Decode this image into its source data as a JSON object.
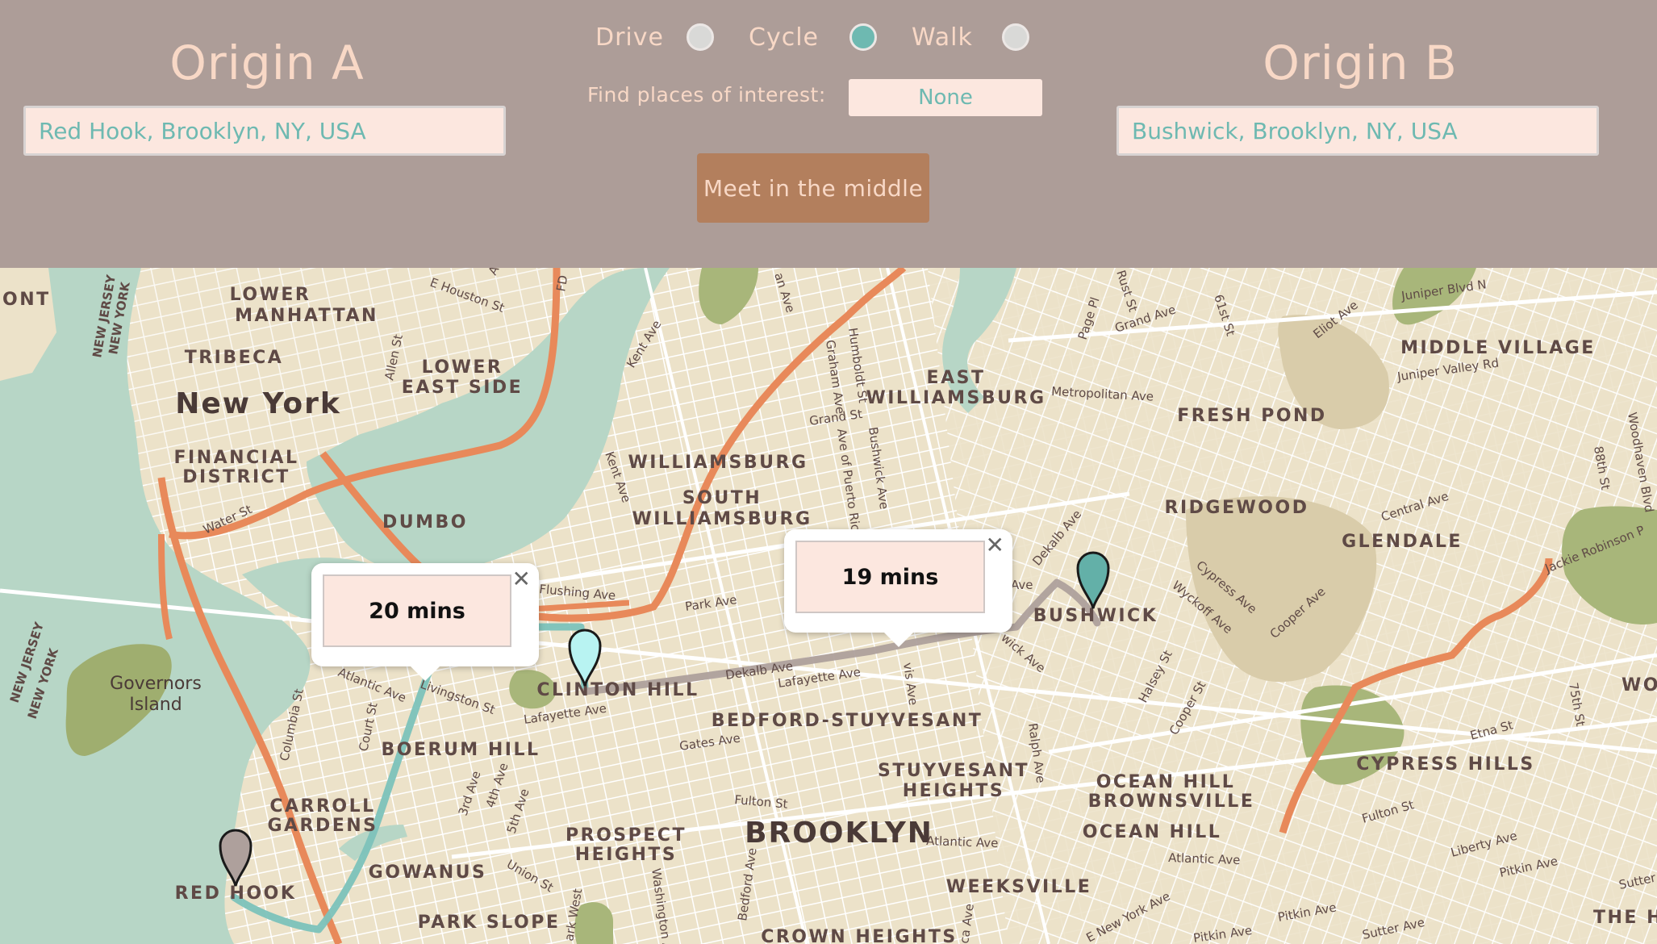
{
  "header": {
    "origin_a": {
      "title": "Origin A",
      "value": "Red Hook, Brooklyn, NY, USA"
    },
    "origin_b": {
      "title": "Origin B",
      "value": "Bushwick, Brooklyn, NY, USA"
    },
    "modes": [
      {
        "label": "Drive",
        "selected": false
      },
      {
        "label": "Cycle",
        "selected": true
      },
      {
        "label": "Walk",
        "selected": false
      }
    ],
    "poi_label": "Find places of interest:",
    "poi_value": "None",
    "meet_button": "Meet in the middle"
  },
  "colors": {
    "header_bg": "#ad9d98",
    "accent_teal": "#6eb9b1",
    "header_text": "#f8d8c6",
    "button_bg": "#b37f5d",
    "route_a": "#7cc2bb",
    "route_b": "#aea09c",
    "highway": "#e8895a"
  },
  "map": {
    "info_windows": [
      {
        "id": "a",
        "text": "20 mins"
      },
      {
        "id": "b",
        "text": "19 mins"
      }
    ],
    "markers": [
      {
        "name": "origin-a-marker",
        "color": "#aea09c"
      },
      {
        "name": "midpoint-marker",
        "color": "#b8f3f2"
      },
      {
        "name": "origin-b-marker",
        "color": "#63b0a8"
      }
    ],
    "neighborhoods": {
      "lower_manhattan_1": "LOWER",
      "lower_manhattan_2": "MANHATTAN",
      "tribeca": "TRIBECA",
      "lower_east_side_1": "LOWER",
      "lower_east_side_2": "EAST SIDE",
      "financial_district_1": "FINANCIAL",
      "financial_district_2": "DISTRICT",
      "dumbo": "DUMBO",
      "east_williamsburg_1": "EAST",
      "east_williamsburg_2": "WILLIAMSBURG",
      "williamsburg": "WILLIAMSBURG",
      "south_williamsburg_1": "SOUTH",
      "south_williamsburg_2": "WILLIAMSBURG",
      "fresh_pond": "FRESH POND",
      "ridgewood": "RIDGEWOOD",
      "middle_village": "MIDDLE VILLAGE",
      "glendale": "GLENDALE",
      "bushwick": "BUSHWICK",
      "clinton_hill": "CLINTON HILL",
      "bedford_stuyvesant": "BEDFORD-STUYVESANT",
      "boerum_hill": "BOERUM HILL",
      "stuyvesant_heights_1": "STUYVESANT",
      "stuyvesant_heights_2": "HEIGHTS",
      "ocean_hill_brownsville_1": "OCEAN HILL",
      "ocean_hill_brownsville_2": "BROWNSVILLE",
      "ocean_hill": "OCEAN HILL",
      "cypress_hills": "CYPRESS HILLS",
      "carroll_gardens_1": "CARROLL",
      "carroll_gardens_2": "GARDENS",
      "prospect_heights_1": "PROSPECT",
      "prospect_heights_2": "HEIGHTS",
      "gowanus": "GOWANUS",
      "red_hook": "RED HOOK",
      "park_slope": "PARK SLOPE",
      "weeksville": "WEEKSVILLE",
      "crown_heights": "CROWN HEIGHTS",
      "wood": "WOOD",
      "the_ho": "THE HO",
      "ont": "ONT"
    },
    "cities": {
      "new_york": "New York",
      "brooklyn": "BROOKLYN"
    },
    "water": {
      "governors_1": "Governors",
      "governors_2": "Island"
    },
    "boundary_labels": {
      "nj_ny_top_1": "NEW JERSEY",
      "nj_ny_top_2": "NEW YORK",
      "nj_ny_bottom_1": "NEW JERSEY",
      "nj_ny_bottom_2": "NEW YORK"
    },
    "streets": {
      "e_houston": "E Houston St",
      "allen": "Allen St",
      "water_st": "Water St",
      "kent_ave_1": "Kent Ave",
      "kent_ave_2": "Kent Ave",
      "grand_st": "Grand St",
      "graham": "Graham Ave",
      "humboldt": "Humboldt St",
      "ave_puerto_rico": "Ave of Puerto Rico",
      "bushwick_ave": "Bushwick Ave",
      "metropolitan": "Metropolitan Ave",
      "grand_ave": "Grand Ave",
      "page_pl": "Page Pl",
      "rust_st": "Rust St",
      "61st": "61st St",
      "eliot": "Eliot Ave",
      "juniper_blvd": "Juniper Blvd N",
      "juniper_valley": "Juniper Valley Rd",
      "woodhaven": "Woodhaven Blvd",
      "88th": "88th St",
      "central_ave": "Central Ave",
      "jackie": "Jackie Robinson P",
      "flushing": "Flushing Ave",
      "park_ave": "Park Ave",
      "dekalb_1": "Dekalb Ave",
      "dekalb_2": "Dekalb Ave",
      "lafayette_1": "Lafayette Ave",
      "lafayette_2": "Lafayette Ave",
      "atlantic_1": "Atlantic Ave",
      "atlantic_2": "Atlantic Ave",
      "atlantic_3": "Atlantic Ave",
      "livingston": "Livingston St",
      "court": "Court St",
      "columbia": "Columbia St",
      "3rd_ave": "3rd Ave",
      "4th_ave": "4th Ave",
      "5th_ave": "5th Ave",
      "gates": "Gates Ave",
      "fulton_1": "Fulton St",
      "fulton_2": "Fulton St",
      "union": "Union St",
      "washington": "Washington A",
      "bedford_ave": "Bedford Ave",
      "ralph": "Ralph Ave",
      "wyckoff": "Wyckoff Ave",
      "cypress": "Cypress Ave",
      "cooper_1": "Cooper Ave",
      "cooper_2": "Cooper St",
      "halsey": "Halsey St",
      "etna": "Etna St",
      "75th": "75th St",
      "liberty": "Liberty Ave",
      "pitkin_1": "Pitkin Ave",
      "pitkin_2": "Pitkin Ave",
      "pitkin_3": "Pitkin Ave",
      "sutter_1": "Sutter Ave",
      "sutter_2": "Sutter Ave",
      "e_new_york": "E New York Ave",
      "wick": "wick Ave",
      "vis": "vis Ave",
      "ave": "Ave",
      "ave_top": "Aven",
      "fd": "FD",
      "an_ave": "an Ave",
      "ark_west": "ark West",
      "ca_ave": "ca Ave"
    }
  }
}
